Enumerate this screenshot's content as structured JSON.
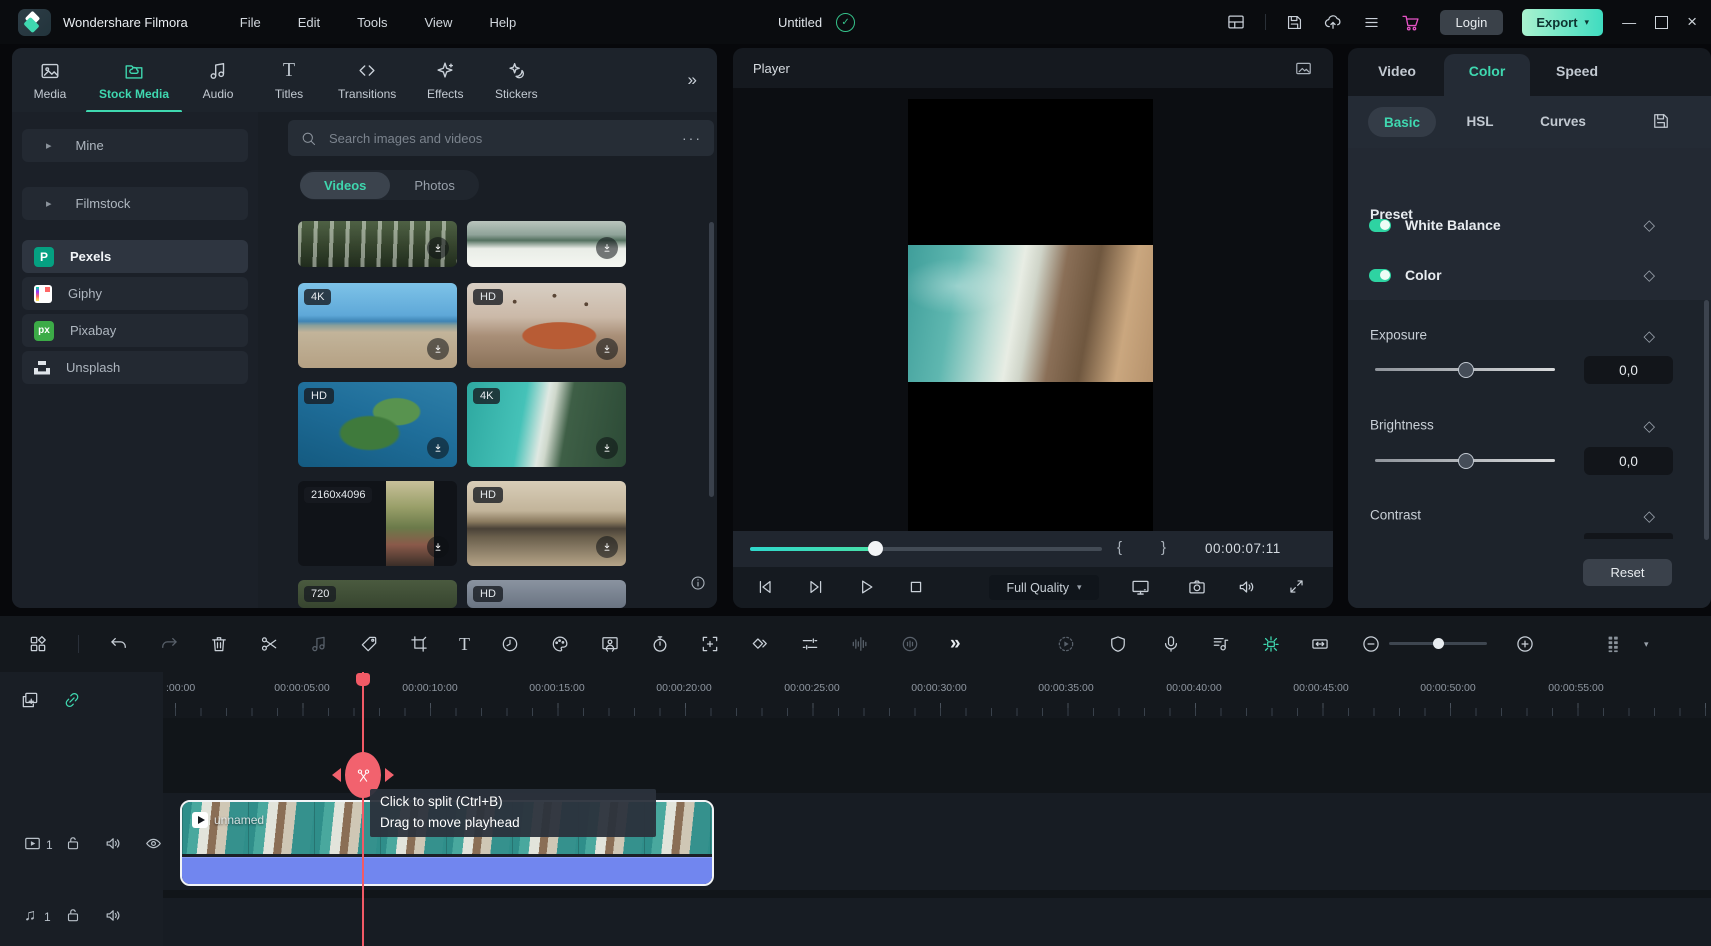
{
  "colors": {
    "accent": "#3fd8b0",
    "playhead": "#f25a66",
    "clip_audio": "#7186ef",
    "export_gradient_start": "#a9f2cf",
    "export_gradient_end": "#3fdcc0",
    "cart": "#e553c5",
    "toggle_on": "#2ed3a2"
  },
  "icons": {
    "more_ellipsis": "···",
    "tabs_overflow": "»",
    "sidebar_collapse": "‹",
    "chevron_down": "▾",
    "mark_in": "{",
    "mark_out": "}",
    "keyframe": "◇",
    "music_note": "♫",
    "group_arrow": "▸",
    "toolbar_more": "»",
    "minimize": "—",
    "close": "×",
    "check": "✓",
    "pexels_logo": "P",
    "pixabay_logo": "px"
  },
  "topbar": {
    "app_title": "Wondershare Filmora",
    "menus": [
      "File",
      "Edit",
      "Tools",
      "View",
      "Help"
    ],
    "project_name": "Untitled",
    "login_label": "Login",
    "export_label": "Export"
  },
  "media_panel": {
    "tabs": [
      "Media",
      "Stock Media",
      "Audio",
      "Titles",
      "Transitions",
      "Effects",
      "Stickers"
    ],
    "active_tab": "Stock Media",
    "sources": [
      "Mine",
      "Filmstock",
      "Pexels",
      "Giphy",
      "Pixabay",
      "Unsplash"
    ],
    "active_source": "Pexels",
    "search_placeholder": "Search images and videos",
    "filter_tabs": [
      "Videos",
      "Photos"
    ],
    "active_filter": "Videos",
    "badges": {
      "r2c1": "4K",
      "r2c2": "HD",
      "r3c1": "HD",
      "r3c2": "4K",
      "r4c1": "2160x4096",
      "r4c2": "HD",
      "r5c1": "720",
      "r5c2": "HD"
    }
  },
  "player": {
    "title": "Player",
    "quality_label": "Full Quality",
    "timecode": "00:00:07:11"
  },
  "properties_panel": {
    "tabs": [
      "Video",
      "Color",
      "Speed"
    ],
    "active_tab": "Color",
    "subtabs": [
      "Basic",
      "HSL",
      "Curves"
    ],
    "active_subtab": "Basic",
    "preset_label": "Preset",
    "toggles": [
      {
        "label": "White Balance",
        "state": "on"
      },
      {
        "label": "Color",
        "state": "on"
      }
    ],
    "sliders": [
      {
        "label": "Exposure",
        "value": "0,0"
      },
      {
        "label": "Brightness",
        "value": "0,0"
      },
      {
        "label": "Contrast",
        "value": ""
      }
    ],
    "reset_label": "Reset"
  },
  "timeline": {
    "ruler_labels": [
      ":00:00",
      "00:00:05:00",
      "00:00:10:00",
      "00:00:15:00",
      "00:00:20:00",
      "00:00:25:00",
      "00:00:30:00",
      "00:00:35:00",
      "00:00:40:00",
      "00:00:45:00",
      "00:00:50:00",
      "00:00:55:00"
    ],
    "tooltip": {
      "line1": "Click to split (Ctrl+B)",
      "line2": "Drag to move playhead"
    },
    "clip_name": "unnamed",
    "video_track_number": "1",
    "audio_track_number": "1"
  }
}
